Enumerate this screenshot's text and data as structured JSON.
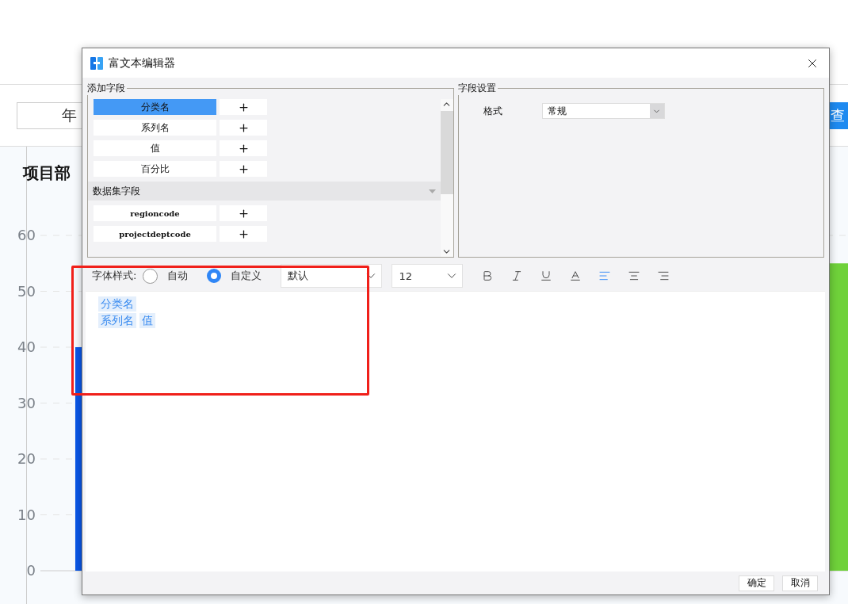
{
  "page": {
    "filter": {
      "value": "年"
    },
    "query_button": "查",
    "chart": {
      "title": "项目部",
      "chart_data": {
        "type": "bar",
        "grid": true,
        "ylim": [
          0,
          60
        ],
        "yticks": [
          0,
          10,
          20,
          30,
          40,
          50,
          60
        ],
        "series": [
          {
            "color": "#0a57e8",
            "values": [
              40,
              null
            ]
          },
          {
            "color": "#6fd13a",
            "values": [
              null,
              55
            ]
          }
        ]
      }
    }
  },
  "dialog": {
    "title": "富文本编辑器",
    "add_fields": {
      "title": "添加字段",
      "items": [
        {
          "label": "分类名",
          "selected": true
        },
        {
          "label": "系列名",
          "selected": false
        },
        {
          "label": "值",
          "selected": false
        },
        {
          "label": "百分比",
          "selected": false
        }
      ],
      "dataset_header": "数据集字段",
      "dataset_items": [
        {
          "label": "regioncode",
          "selected": false
        },
        {
          "label": "projectdeptcode",
          "selected": false
        }
      ]
    },
    "field_settings": {
      "title": "字段设置",
      "format_label": "格式",
      "format_value": "常规"
    },
    "font_style": {
      "label": "字体样式:",
      "options": [
        {
          "label": "自动",
          "selected": false
        },
        {
          "label": "自定义",
          "selected": true
        }
      ],
      "font": "默认",
      "size": "12",
      "format_buttons": [
        {
          "kind": "bold",
          "selected": false
        },
        {
          "kind": "italic",
          "selected": false
        },
        {
          "kind": "underline",
          "selected": false
        },
        {
          "kind": "color",
          "selected": false
        },
        {
          "kind": "align-left",
          "selected": true
        },
        {
          "kind": "align-center",
          "selected": false
        },
        {
          "kind": "align-right",
          "selected": false
        }
      ]
    },
    "editor": {
      "lines": [
        [
          "分类名"
        ],
        [
          "系列名",
          "值"
        ]
      ]
    },
    "buttons": [
      "确定",
      "取消"
    ]
  }
}
